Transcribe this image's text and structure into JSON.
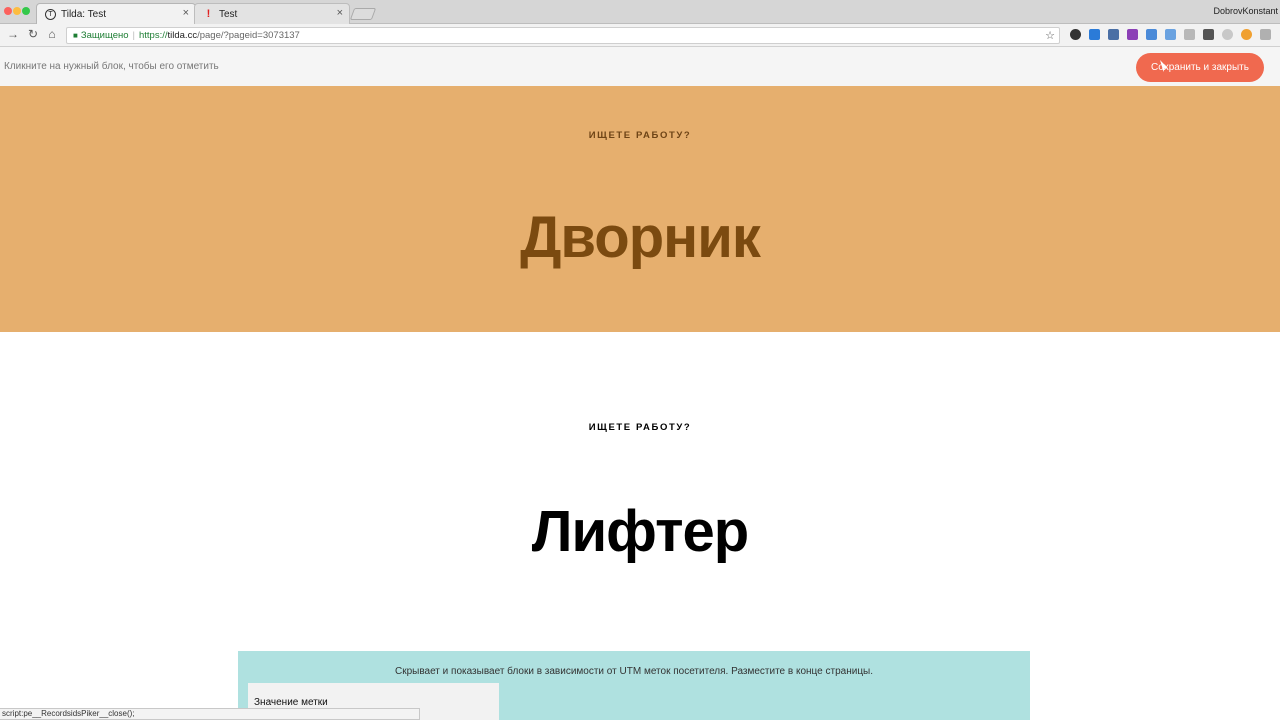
{
  "browser": {
    "tabs": [
      {
        "label": "Tilda: Test"
      },
      {
        "label": "Test"
      }
    ],
    "profile": "DobrovKonstant",
    "url": {
      "secure_label": "Защищено",
      "scheme": "https://",
      "host": "tilda.cc",
      "path": "/page/?pageid=3073137"
    },
    "status_text": "script:pe__RecordsidsPiker__close();"
  },
  "editor": {
    "hint": "Кликните на нужный блок, чтобы его отметить",
    "save_label": "Сохранить и закрыть"
  },
  "blocks": [
    {
      "eyebrow": "ИЩЕТЕ РАБОТУ?",
      "title": "Дворник",
      "background": "#e6af6e",
      "text_color": "#7b4a10"
    },
    {
      "eyebrow": "ИЩЕТЕ РАБОТУ?",
      "title": "Лифтер",
      "background": "#ffffff",
      "text_color": "#000000"
    }
  ],
  "utm": {
    "description": "Скрывает и показывает блоки в зависимости от UTM меток посетителя. Разместите в конце страницы.",
    "field_label": "Значение метки",
    "background": "#afe1e0"
  },
  "colors": {
    "accent": "#f0694f"
  }
}
